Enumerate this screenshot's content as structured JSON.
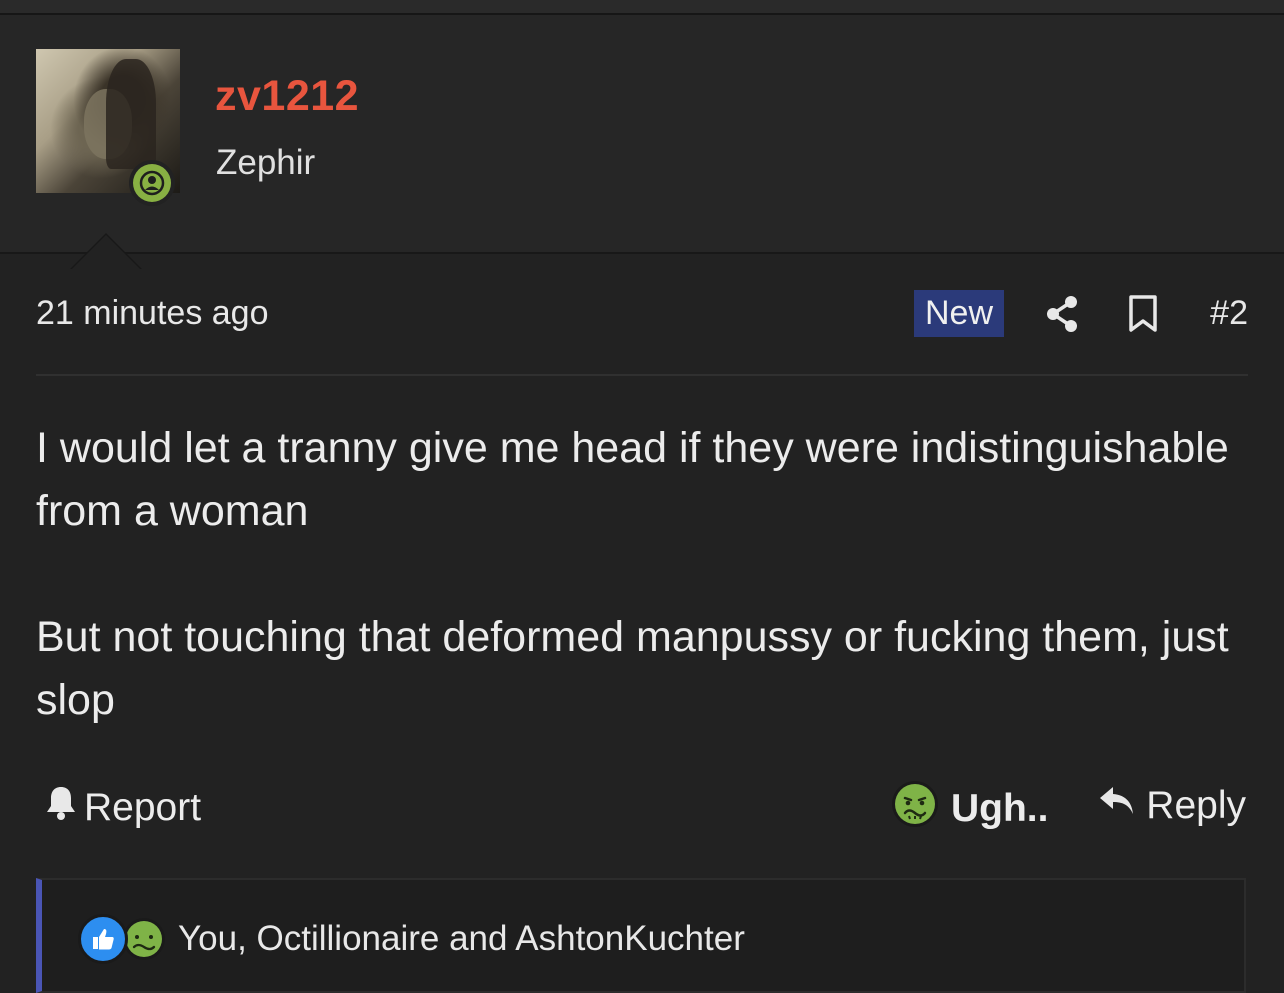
{
  "post": {
    "author": {
      "username": "zv1212",
      "title": "Zephir",
      "online": true
    },
    "timestamp": "21 minutes ago",
    "badge": "New",
    "number": "#2",
    "body": [
      "I would let a tranny give me head if they were indistinguishable from a woman",
      "But not touching that deformed manpussy or fucking them, just slop"
    ],
    "actions": {
      "report": "Report",
      "reaction": "Ugh..",
      "reply": "Reply"
    },
    "reactions": {
      "reactors": "You, Octillionaire and AshtonKuchter",
      "types": [
        "like-icon",
        "sick-face-icon"
      ]
    }
  },
  "colors": {
    "username": "#e8553e",
    "new_badge": "#2b3a7a",
    "online": "#88b043",
    "accent_border": "#4a55b5",
    "like": "#2d8ef0",
    "sick": "#7fb347"
  }
}
